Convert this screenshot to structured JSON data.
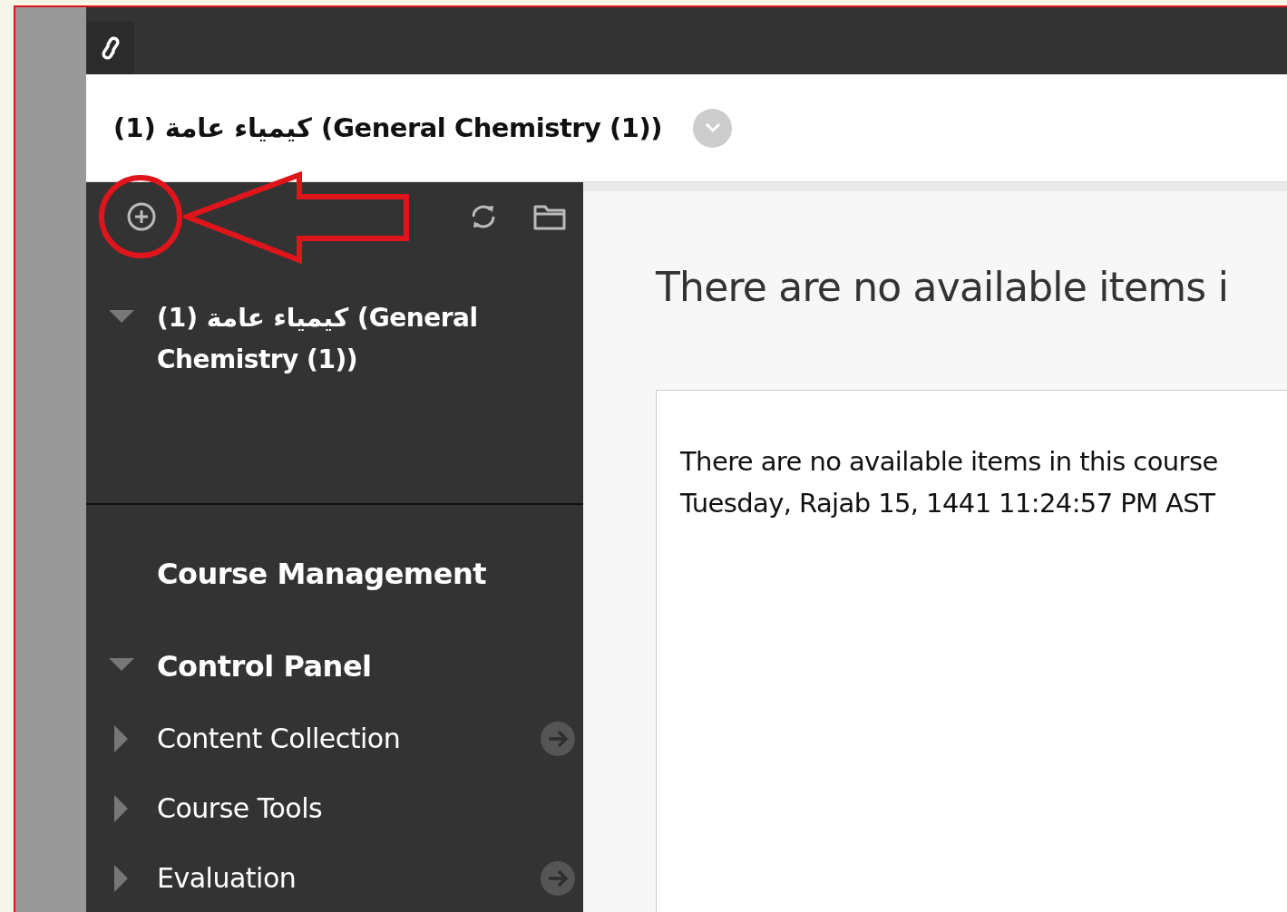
{
  "course_title": "(1) كيمياء عامة (General Chemistry (1))",
  "sidebar": {
    "course": {
      "label": "(1) كيمياء عامة (General Chemistry (1))",
      "expanded": true
    },
    "section_title": "Course Management",
    "control_panel": {
      "label": "Control Panel",
      "expanded": true,
      "children": [
        {
          "label": "Content Collection",
          "expanded": false,
          "go_button": true
        },
        {
          "label": "Course Tools",
          "expanded": false,
          "go_button": false
        },
        {
          "label": "Evaluation",
          "expanded": false,
          "go_button": true
        }
      ]
    }
  },
  "content": {
    "heading": "There are no available items i",
    "message_lines": [
      "There are no available items in this course",
      "Tuesday, Rajab 15, 1441 11:24:57 PM AST"
    ]
  }
}
